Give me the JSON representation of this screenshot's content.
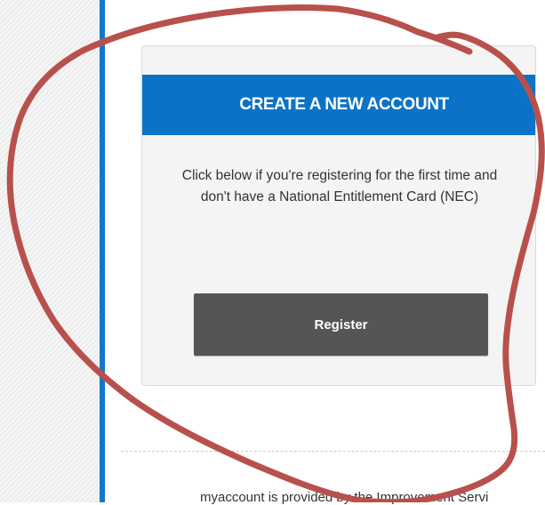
{
  "card": {
    "title": "CREATE A NEW ACCOUNT",
    "description_line1": "Click below if you're registering for the first time and",
    "description_line2": "don't have a National Entitlement Card (NEC)",
    "register_label": "Register"
  },
  "footer": {
    "text": "myaccount is provided by the Improvement Servi"
  },
  "colors": {
    "accent_blue": "#0a73c8",
    "button_gray": "#555555",
    "annotation_red": "#b8504c"
  }
}
